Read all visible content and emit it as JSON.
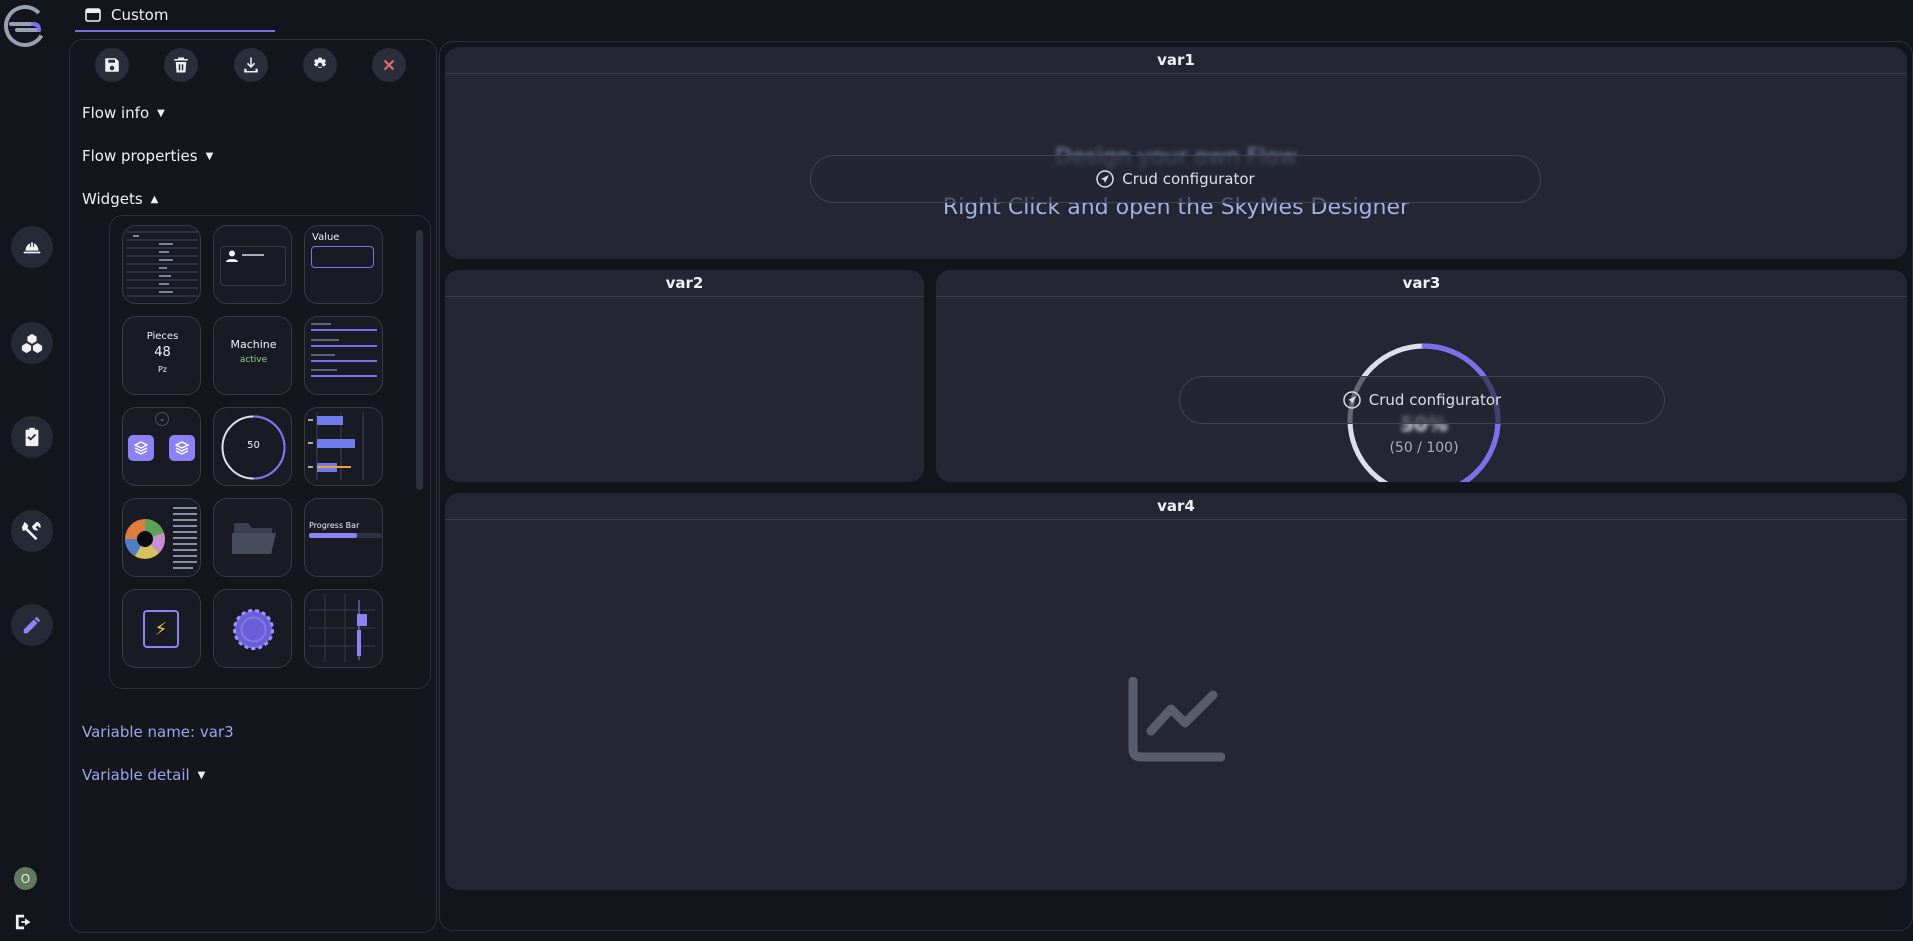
{
  "tab": {
    "label": "Custom"
  },
  "panel": {
    "flow_info": "Flow info",
    "flow_properties": "Flow properties",
    "widgets": "Widgets",
    "variable_name": "Variable name: var3",
    "variable_detail": "Variable detail"
  },
  "widgets": {
    "value_label": "Value",
    "pieces_label": "Pieces",
    "pieces_value": "48",
    "pieces_unit": "Pz",
    "machine_label": "Machine",
    "machine_status": "active",
    "gauge_value": "50",
    "progress_label": "Progress Bar"
  },
  "cards": {
    "var1": {
      "title": "var1",
      "line1": "Design your own Flow",
      "line2": "Right Click and open the SkyMes Designer",
      "crud": "Crud configurator"
    },
    "var2": {
      "title": "var2"
    },
    "var3": {
      "title": "var3",
      "gauge_pct": "50%",
      "gauge_fraction": "(50 / 100)",
      "crud": "Crud configurator",
      "gauge_value": 50,
      "gauge_max": 100
    },
    "var4": {
      "title": "var4"
    }
  },
  "user": {
    "initial": "O"
  },
  "colors": {
    "accent": "#7b6ff0",
    "bg": "#13151c",
    "card": "#242733",
    "close": "#e06a6a"
  }
}
